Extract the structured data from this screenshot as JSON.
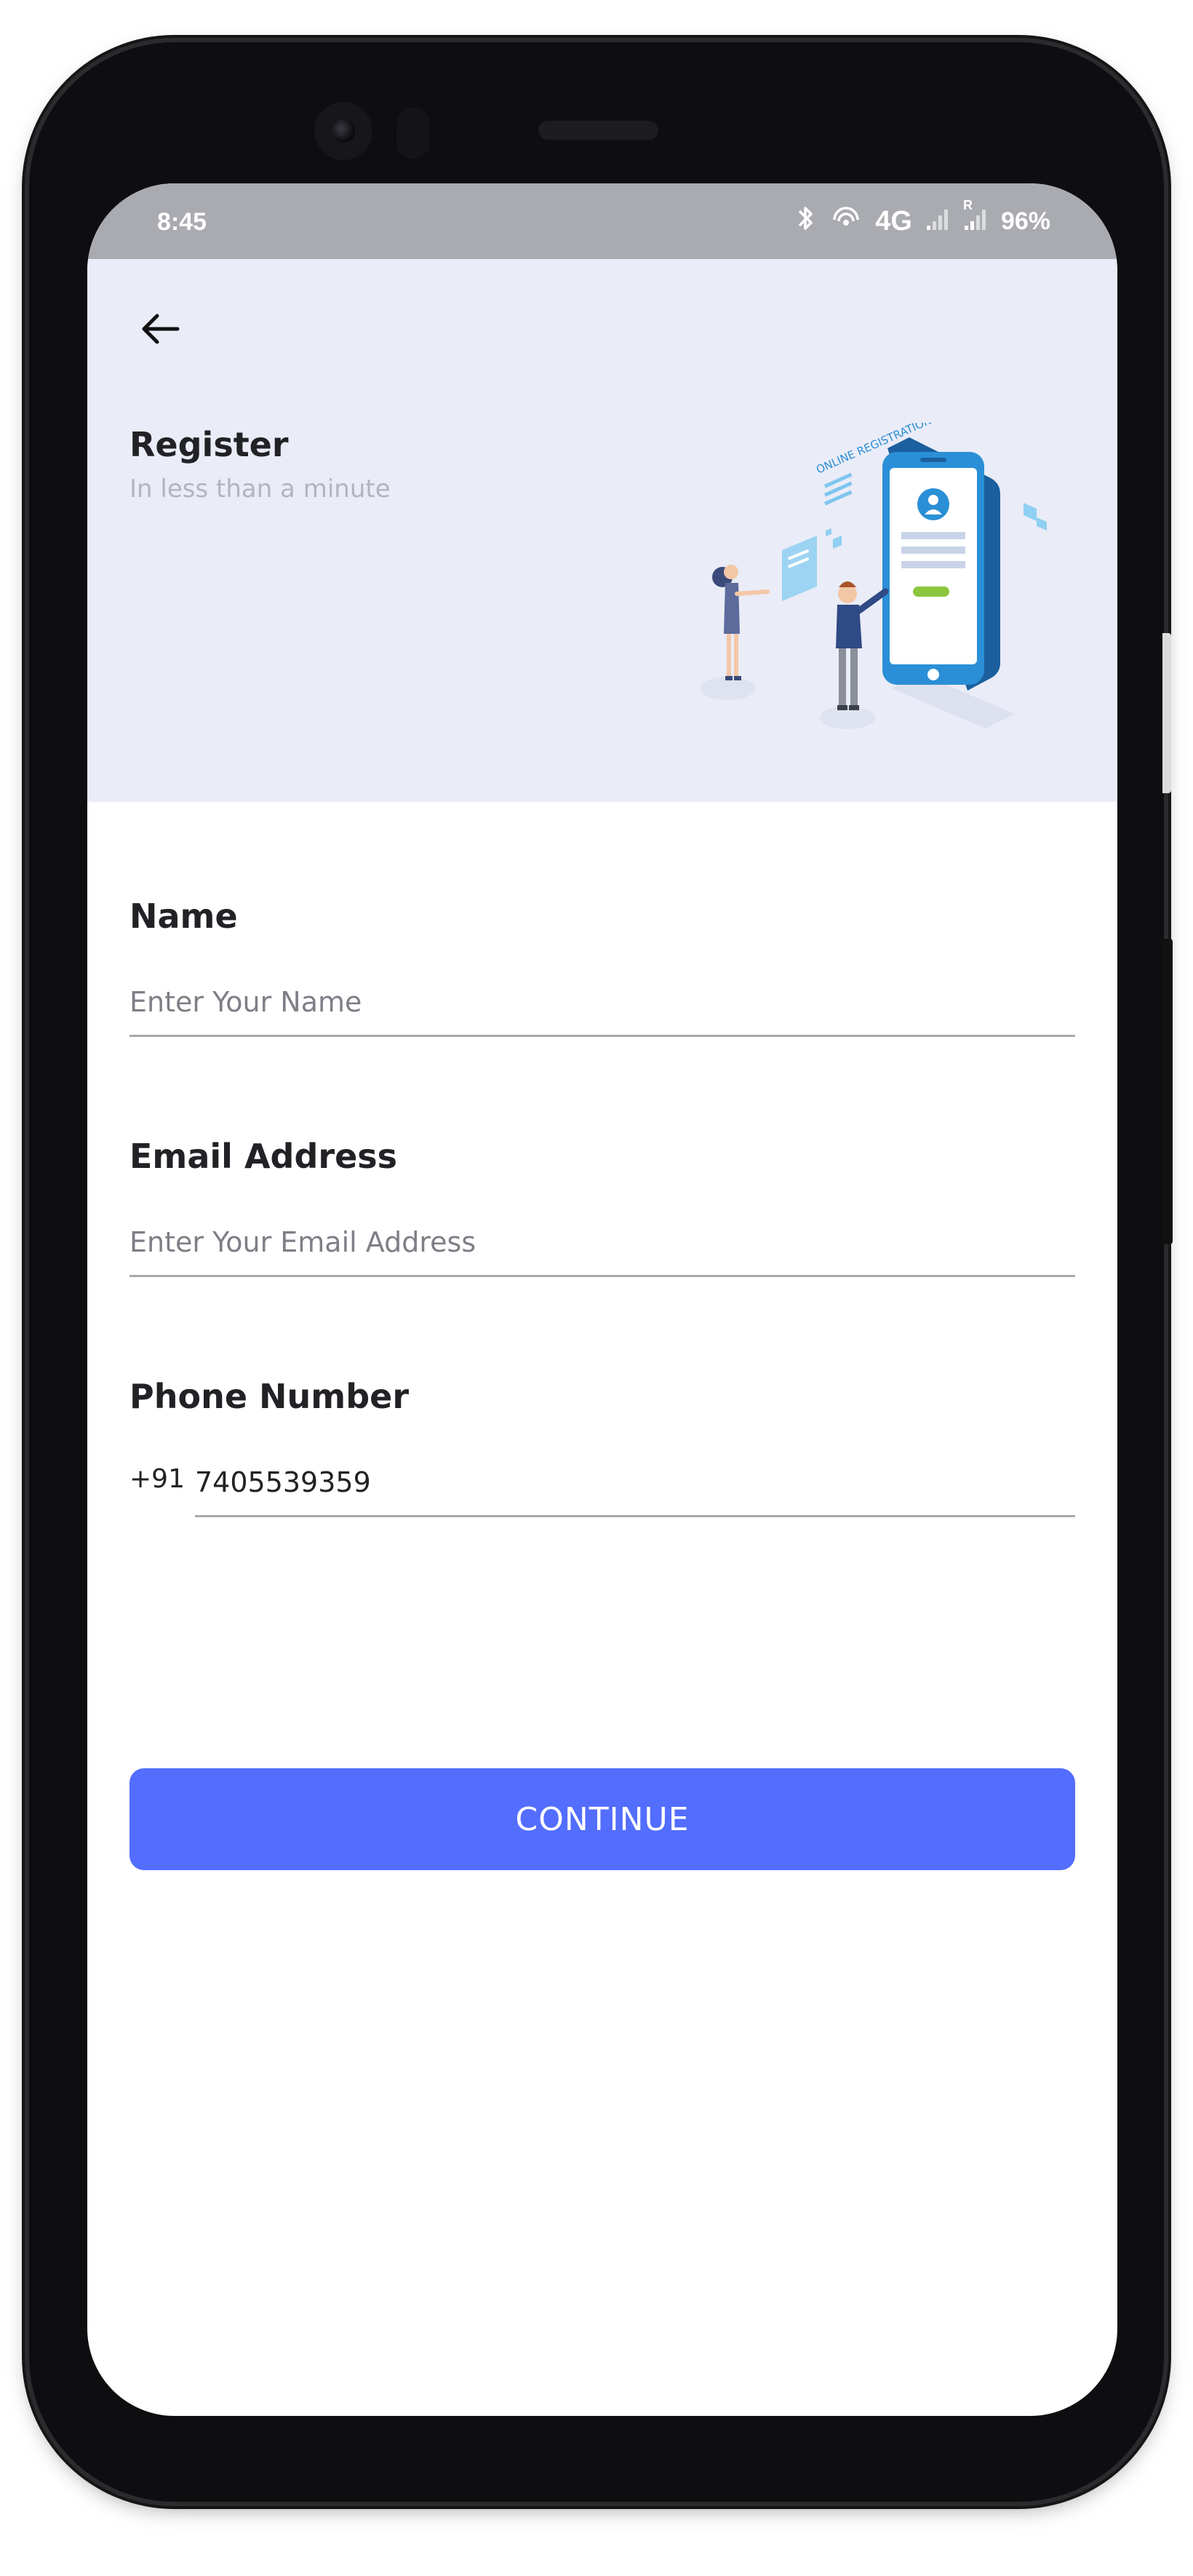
{
  "status_bar": {
    "time": "8:45",
    "network": "4G",
    "battery": "96%",
    "icons": [
      "bluetooth-icon",
      "hotspot-icon",
      "signal-icon",
      "signal-roaming-icon"
    ],
    "roaming_mark": "R"
  },
  "header": {
    "back_icon": "arrow-left-icon",
    "title": "Register",
    "subtitle": "In less than a minute",
    "illustration_text": "ONLINE REGISTRATION",
    "background": "#eaecf7"
  },
  "form": {
    "name": {
      "label": "Name",
      "placeholder": "Enter Your Name",
      "value": ""
    },
    "email": {
      "label": "Email Address",
      "placeholder": "Enter Your Email Address",
      "value": ""
    },
    "phone": {
      "label": "Phone Number",
      "country_code": "+91",
      "value": "7405539359"
    },
    "continue_label": "CONTINUE"
  },
  "colors": {
    "accent": "#536dfe",
    "text": "#222226",
    "muted": "#b3b5bd",
    "status_bar": "#a9abb0"
  }
}
